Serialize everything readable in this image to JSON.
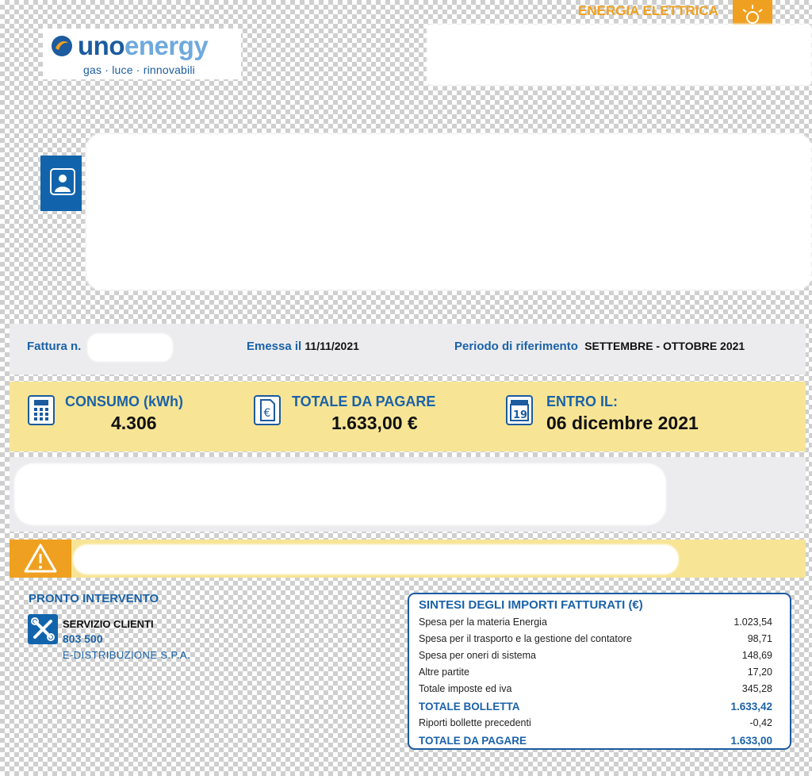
{
  "header": {
    "logo_uno": "uno",
    "logo_energy": "energy",
    "logo_tagline": "gas · luce · rinnovabili",
    "service_type": "ENERGIA ELETTRICA"
  },
  "invoice": {
    "number_label": "Fattura n.",
    "issued_label": "Emessa il",
    "issued_date": "11/11/2021",
    "period_label": "Periodo di riferimento",
    "period_value": "SETTEMBRE - OTTOBRE 2021"
  },
  "summary": {
    "consumption_label": "CONSUMO (kWh)",
    "consumption_value": "4.306",
    "total_label": "TOTALE DA PAGARE",
    "total_value": "1.633,00 €",
    "due_label": "ENTRO IL:",
    "due_value": "06 dicembre 2021",
    "calendar_day": "19"
  },
  "pronto_intervento": {
    "title": "PRONTO INTERVENTO",
    "service_name": "SERVIZIO CLIENTI",
    "phone": "803 500",
    "company": "E-DISTRIBUZIONE S.P.A."
  },
  "sintesi": {
    "title": "SINTESI DEGLI IMPORTI FATTURATI (€)",
    "rows": [
      {
        "label": "Spesa per la materia Energia",
        "value": "1.023,54"
      },
      {
        "label": "Spesa per il trasporto e la gestione del contatore",
        "value": "98,71"
      },
      {
        "label": "Spesa per oneri di sistema",
        "value": "148,69"
      },
      {
        "label": "Altre partite",
        "value": "17,20"
      },
      {
        "label": "Totale imposte ed iva",
        "value": "345,28"
      },
      {
        "label": "TOTALE BOLLETTA",
        "value": "1.633,42"
      },
      {
        "label": "Riporti bollette precedenti",
        "value": "-0,42"
      },
      {
        "label": "TOTALE DA PAGARE",
        "value": "1.633,00"
      }
    ]
  },
  "colors": {
    "brand_blue": "#1b62a8",
    "accent_orange": "#f0a020",
    "highlight_yellow": "#f7e595"
  }
}
